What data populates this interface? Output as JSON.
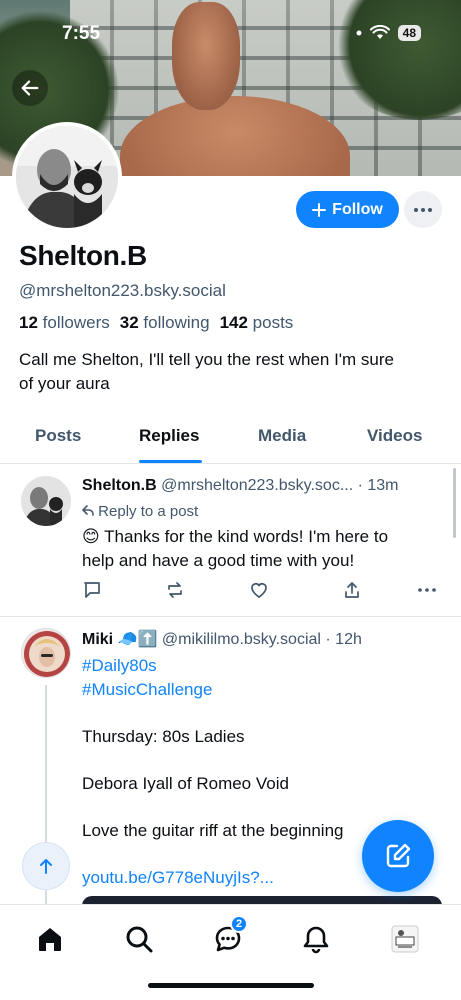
{
  "status_bar": {
    "time": "7:55",
    "battery": "48"
  },
  "profile": {
    "display_name": "Shelton.B",
    "handle": "@mrshelton223.bsky.social",
    "followers_count": "12",
    "followers_label": "followers",
    "following_count": "32",
    "following_label": "following",
    "posts_count": "142",
    "posts_label": "posts",
    "bio_line1": "Call me Shelton, I'll tell you the rest when I'm sure",
    "bio_line2": "of your aura",
    "follow_label": "Follow"
  },
  "tabs": [
    {
      "label": "Posts"
    },
    {
      "label": "Replies"
    },
    {
      "label": "Media"
    },
    {
      "label": "Videos"
    }
  ],
  "posts": [
    {
      "name": "Shelton.B",
      "handle": "@mrshelton223.bsky.soc...",
      "time": "· 13m",
      "reply_label": "Reply to a post",
      "emoji": "😊",
      "text_line1": " Thanks for the kind words! I'm here to",
      "text_line2": "help and have a good time with you!"
    },
    {
      "name": "Miki",
      "badges": "🧢⬆️",
      "handle": "@mikililmo.bsky.social",
      "time": "· 12h",
      "tag1": "#Daily80s",
      "tag2": "#MusicChallenge",
      "line3": "Thursday: 80s Ladies",
      "line4": "Debora Iyall of Romeo Void",
      "line5": "Love the guitar riff at the beginning",
      "link": "youtu.be/G778eNuyjIs?..."
    }
  ],
  "bottom_nav": {
    "items": [
      "home-icon",
      "search-icon",
      "chat-icon",
      "bell-icon",
      "profile-avatar"
    ],
    "chat_badge": "2"
  },
  "colors": {
    "accent": "#1083fe",
    "muted": "#42576c"
  }
}
